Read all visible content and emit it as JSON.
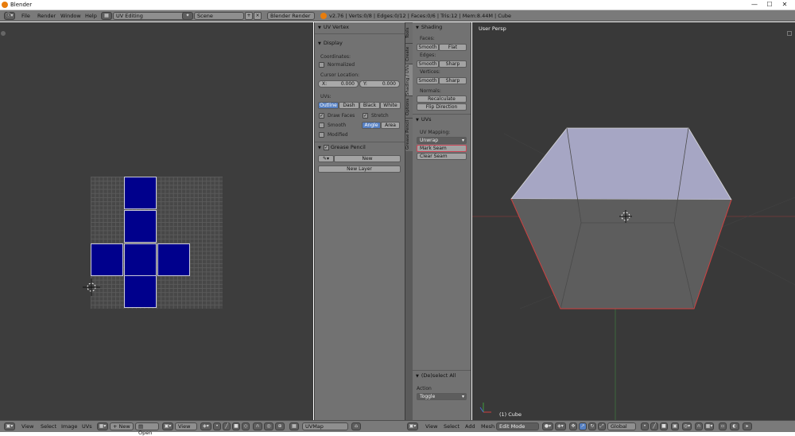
{
  "window": {
    "title": "Blender",
    "minimize": "—",
    "maximize": "☐",
    "close": "✕"
  },
  "infobar": {
    "menus": [
      "File",
      "Render",
      "Window",
      "Help"
    ],
    "layout": "UV Editing",
    "scene": "Scene",
    "engine": "Blender Render",
    "stats": "v2.76 | Verts:0/8 | Edges:0/12 | Faces:0/6 | Tris:12 | Mem:8.44M | Cube"
  },
  "npanel": {
    "uv_vertex_header": "UV Vertex",
    "display_header": "Display",
    "coordinates_label": "Coordinates:",
    "normalized_label": "Normalized",
    "cursor_label": "Cursor Location:",
    "cursor_x": "X:",
    "cursor_x_val": "0.000",
    "cursor_y": "Y:",
    "cursor_y_val": "0.000",
    "uvs_label": "UVs:",
    "uv_modes": [
      "Outline",
      "Dash",
      "Black",
      "White"
    ],
    "draw_faces": "Draw Faces",
    "stretch": "Stretch",
    "smooth": "Smooth",
    "angle": "Angle",
    "area": "Area",
    "modified": "Modified",
    "grease_pencil_header": "Grease Pencil",
    "new_label": "New",
    "new_layer_label": "New Layer"
  },
  "tooltabs": [
    "Tools",
    "Create",
    "Shading / UVs",
    "Options",
    "Grease Pencil"
  ],
  "toolshelf": {
    "shading_header": "Shading",
    "faces_label": "Faces:",
    "edges_label": "Edges:",
    "vertices_label": "Vertices:",
    "smooth": "Smooth",
    "flat": "Flat",
    "sharp": "Sharp",
    "normals_label": "Normals:",
    "recalculate": "Recalculate",
    "flip_direction": "Flip Direction",
    "uvs_header": "UVs",
    "uv_mapping_label": "UV Mapping:",
    "unwrap": "Unwrap",
    "mark_seam": "Mark Seam",
    "clear_seam": "Clear Seam",
    "deselect_header": "(De)select All",
    "action_label": "Action",
    "action_value": "Toggle"
  },
  "viewport": {
    "view_label": "User Persp",
    "object_label": "(1) Cube"
  },
  "bottombar": {
    "uv_menus": [
      "View",
      "Select",
      "Image",
      "UVs"
    ],
    "new_label": "New",
    "open_label": "Open",
    "view_dd": "View",
    "uvmap": "UVMap",
    "vp_menus": [
      "View",
      "Select",
      "Add",
      "Mesh"
    ],
    "mode": "Edit Mode",
    "orientation": "Global"
  },
  "colors": {
    "uv_face": "#00008c",
    "selection": "#5680c2",
    "seam": "#d04040"
  }
}
